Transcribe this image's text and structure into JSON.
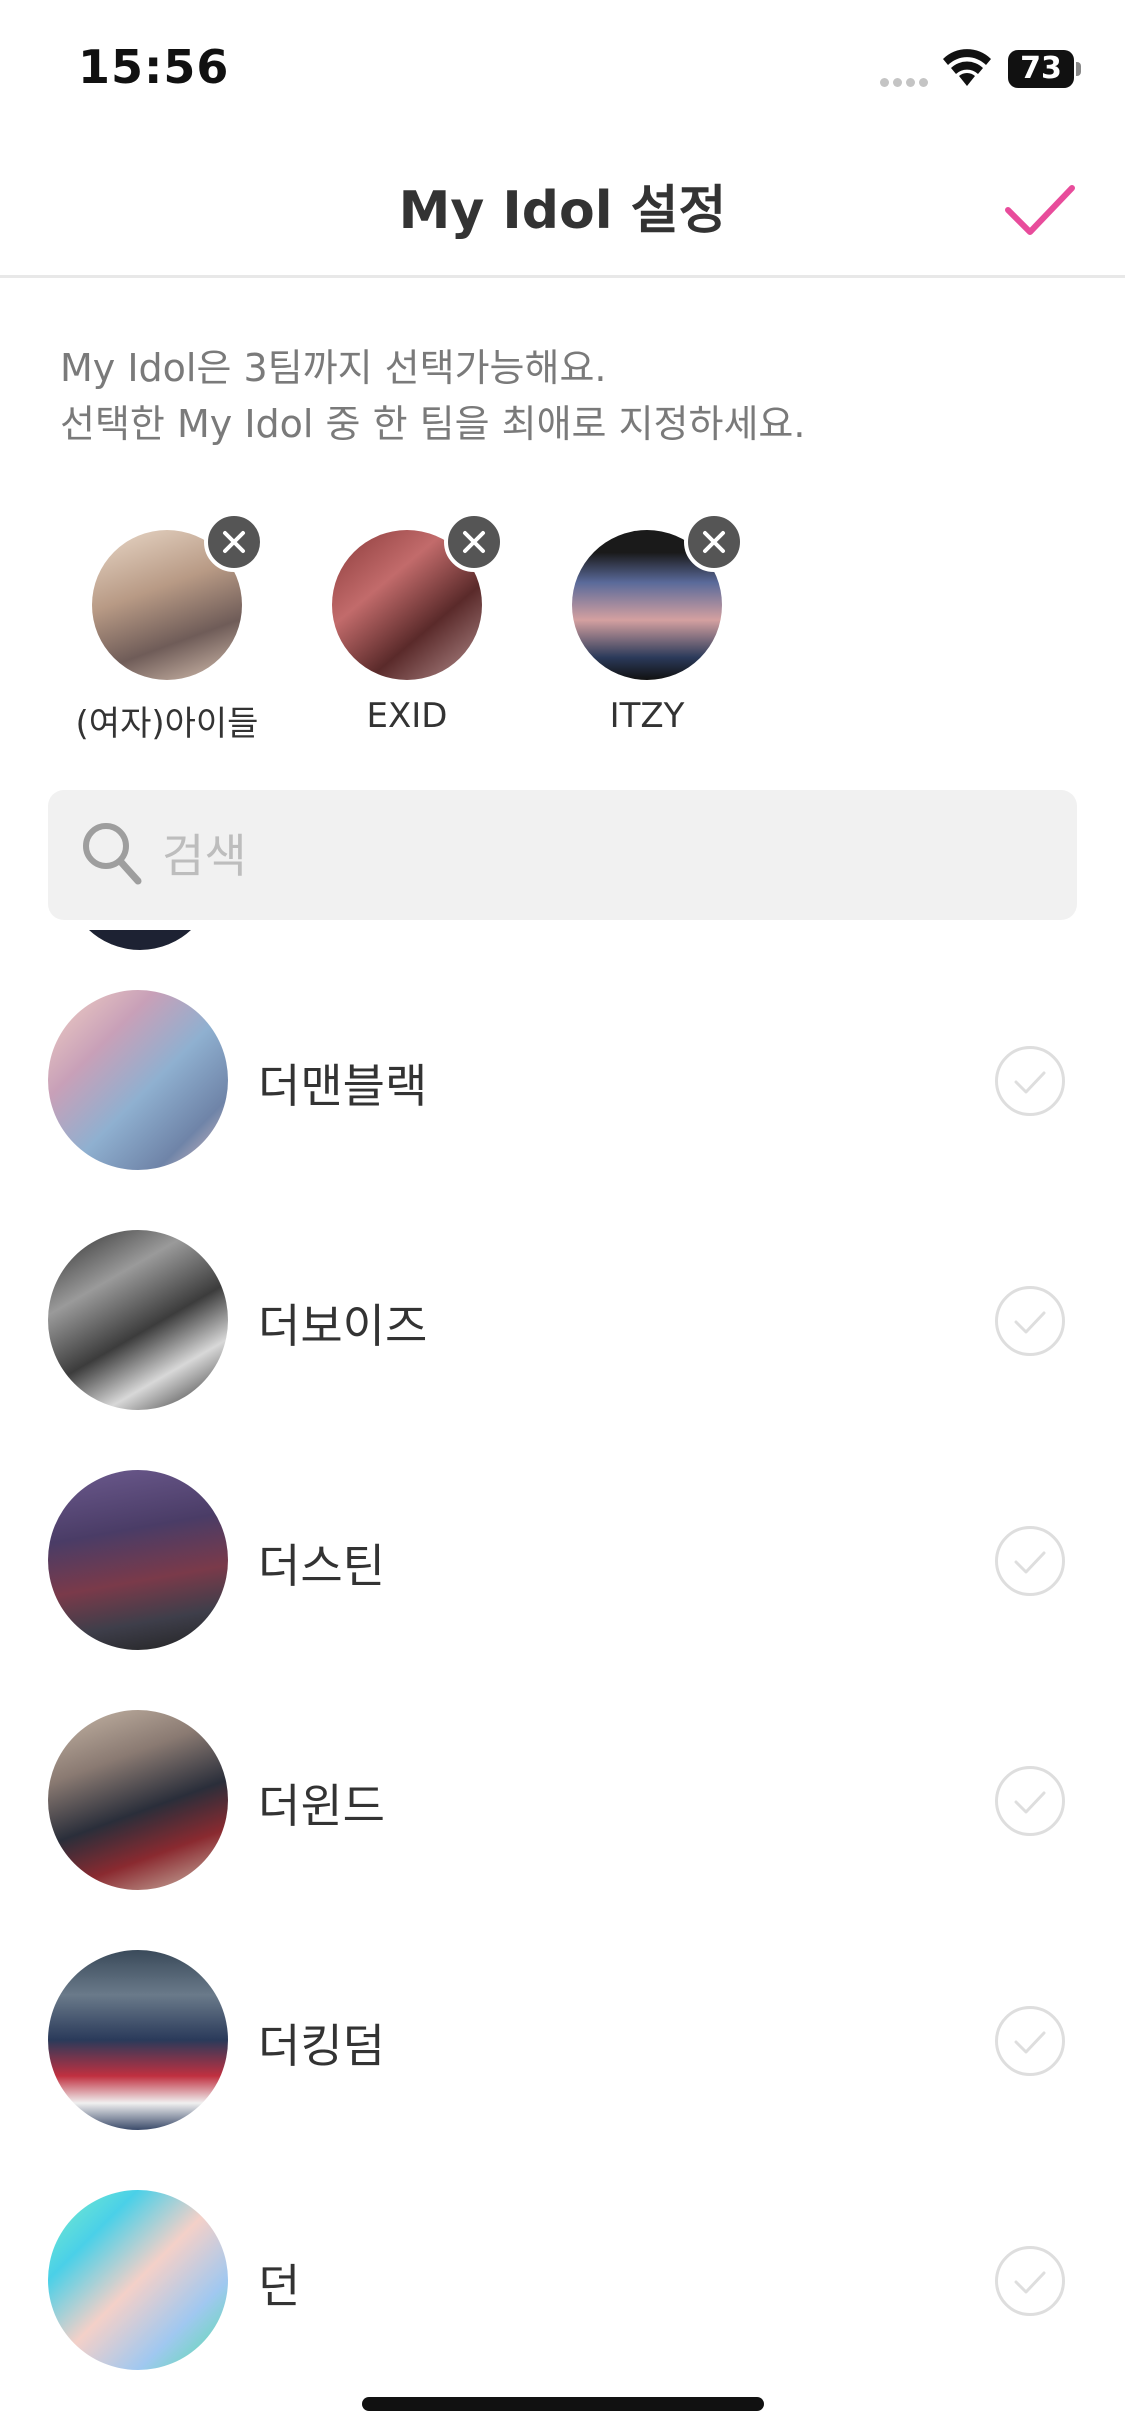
{
  "status_bar": {
    "time": "15:56",
    "battery": "73"
  },
  "header": {
    "title": "My Idol 설정",
    "confirm_icon": "checkmark-icon",
    "accent_color": "#e84c9b"
  },
  "description": {
    "line1": "My Idol은 3팀까지 선택가능해요.",
    "line2": "선택한 My Idol 중 한 팀을 최애로 지정하세요."
  },
  "selected": [
    {
      "label": "(여자)아이들"
    },
    {
      "label": "EXID"
    },
    {
      "label": "ITZY"
    }
  ],
  "search": {
    "placeholder": "검색",
    "value": ""
  },
  "list": [
    {
      "name": "더맨블랙"
    },
    {
      "name": "더보이즈"
    },
    {
      "name": "더스틴"
    },
    {
      "name": "더윈드"
    },
    {
      "name": "더킹덤"
    },
    {
      "name": "던"
    }
  ]
}
